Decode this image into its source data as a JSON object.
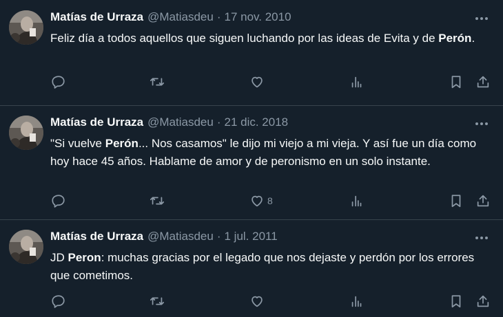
{
  "tweets": [
    {
      "name": "Matías de Urraza",
      "handle": "@Matiasdeu",
      "separator": "·",
      "date": "17 nov. 2010",
      "text_parts": [
        "Feliz día a todos aquellos que siguen luchando por las ideas de Evita y de ",
        "Perón",
        "."
      ],
      "like_count": ""
    },
    {
      "name": "Matías de Urraza",
      "handle": "@Matiasdeu",
      "separator": "·",
      "date": "21 dic. 2018",
      "text_parts": [
        "\"Si vuelve ",
        "Perón",
        "... Nos casamos\" le dijo mi viejo a mi vieja. Y así fue un día como hoy hace 45 años. Hablame de amor y de peronismo en un solo instante."
      ],
      "like_count": "8"
    },
    {
      "name": "Matías de Urraza",
      "handle": "@Matiasdeu",
      "separator": "·",
      "date": "1 jul. 2011",
      "text_parts": [
        "JD ",
        "Peron",
        ": muchas gracias por el legado que nos dejaste y perdón por los errores que cometimos."
      ],
      "like_count": ""
    }
  ],
  "icons": {
    "more": "more-horizontal-icon",
    "reply": "reply-icon",
    "retweet": "retweet-icon",
    "like": "like-icon",
    "views": "views-icon",
    "bookmark": "bookmark-icon",
    "share": "share-icon"
  },
  "colors": {
    "background": "#15202b",
    "text": "#f7f9f9",
    "secondary": "#8b98a5",
    "divider": "#38444d"
  }
}
